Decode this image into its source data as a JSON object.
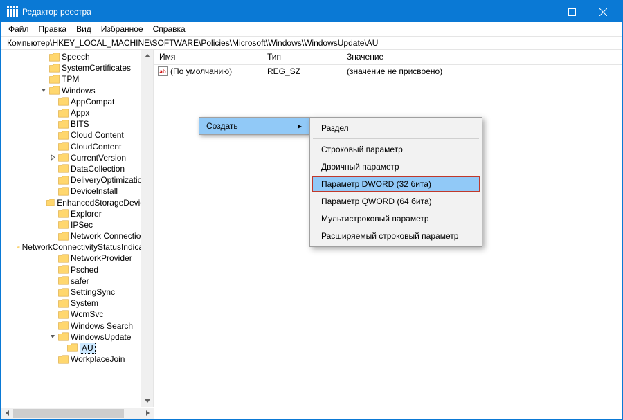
{
  "title": "Редактор реестра",
  "menu": {
    "file": "Файл",
    "edit": "Правка",
    "view": "Вид",
    "favorites": "Избранное",
    "help": "Справка"
  },
  "address": "Компьютер\\HKEY_LOCAL_MACHINE\\SOFTWARE\\Policies\\Microsoft\\Windows\\WindowsUpdate\\AU",
  "tree": [
    {
      "indent": 4,
      "exp": "none",
      "label": "Speech"
    },
    {
      "indent": 4,
      "exp": "none",
      "label": "SystemCertificates"
    },
    {
      "indent": 4,
      "exp": "none",
      "label": "TPM"
    },
    {
      "indent": 4,
      "exp": "open",
      "label": "Windows"
    },
    {
      "indent": 5,
      "exp": "none",
      "label": "AppCompat"
    },
    {
      "indent": 5,
      "exp": "none",
      "label": "Appx"
    },
    {
      "indent": 5,
      "exp": "none",
      "label": "BITS"
    },
    {
      "indent": 5,
      "exp": "none",
      "label": "Cloud Content"
    },
    {
      "indent": 5,
      "exp": "none",
      "label": "CloudContent"
    },
    {
      "indent": 5,
      "exp": "closed",
      "label": "CurrentVersion"
    },
    {
      "indent": 5,
      "exp": "none",
      "label": "DataCollection"
    },
    {
      "indent": 5,
      "exp": "none",
      "label": "DeliveryOptimization"
    },
    {
      "indent": 5,
      "exp": "none",
      "label": "DeviceInstall"
    },
    {
      "indent": 5,
      "exp": "none",
      "label": "EnhancedStorageDevices"
    },
    {
      "indent": 5,
      "exp": "none",
      "label": "Explorer"
    },
    {
      "indent": 5,
      "exp": "none",
      "label": "IPSec"
    },
    {
      "indent": 5,
      "exp": "none",
      "label": "Network Connections"
    },
    {
      "indent": 5,
      "exp": "none",
      "label": "NetworkConnectivityStatusIndicator"
    },
    {
      "indent": 5,
      "exp": "none",
      "label": "NetworkProvider"
    },
    {
      "indent": 5,
      "exp": "none",
      "label": "Psched"
    },
    {
      "indent": 5,
      "exp": "none",
      "label": "safer"
    },
    {
      "indent": 5,
      "exp": "none",
      "label": "SettingSync"
    },
    {
      "indent": 5,
      "exp": "none",
      "label": "System"
    },
    {
      "indent": 5,
      "exp": "none",
      "label": "WcmSvc"
    },
    {
      "indent": 5,
      "exp": "none",
      "label": "Windows Search"
    },
    {
      "indent": 5,
      "exp": "open",
      "label": "WindowsUpdate"
    },
    {
      "indent": 6,
      "exp": "none",
      "label": "AU",
      "selected": true
    },
    {
      "indent": 5,
      "exp": "none",
      "label": "WorkplaceJoin"
    }
  ],
  "columns": {
    "name": "Имя",
    "type": "Тип",
    "data": "Значение"
  },
  "values": [
    {
      "name": "(По умолчанию)",
      "type": "REG_SZ",
      "data": "(значение не присвоено)"
    }
  ],
  "context_menu_1": {
    "create": "Создать"
  },
  "context_menu_2": {
    "key": "Раздел",
    "string": "Строковый параметр",
    "binary": "Двоичный параметр",
    "dword": "Параметр DWORD (32 бита)",
    "qword": "Параметр QWORD (64 бита)",
    "multi": "Мультистроковый параметр",
    "expand": "Расширяемый строковый параметр"
  }
}
